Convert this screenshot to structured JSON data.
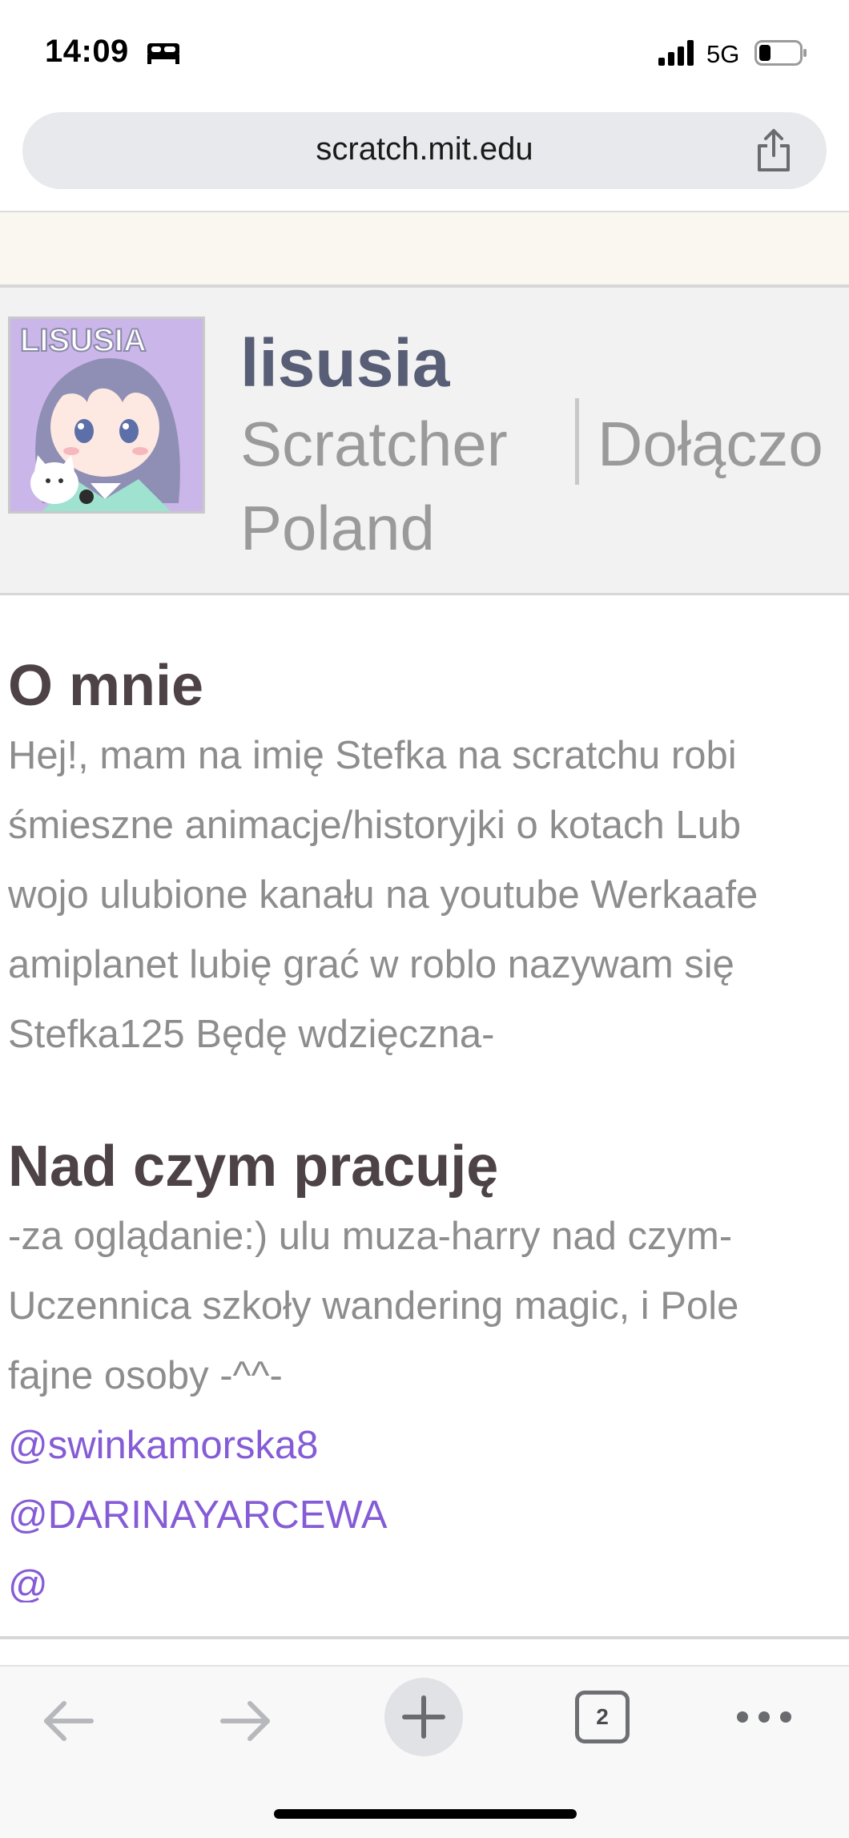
{
  "status": {
    "time": "14:09",
    "network": "5G"
  },
  "browser": {
    "url": "scratch.mit.edu",
    "tab_count": "2"
  },
  "profile": {
    "username": "lisusia",
    "role": "Scratcher",
    "joined": "Dołączo",
    "country": "Poland",
    "avatar_text": "LISUSIA"
  },
  "about": {
    "title": "O mnie",
    "lines": [
      "Hej!, mam na imię Stefka na scratchu robi",
      "śmieszne animacje/historyjki o kotach Lub",
      "wojo ulubione kanału na youtube Werkaafe",
      "amiplanet lubię grać w roblo nazywam się",
      "Stefka125 Będę wdzięczna-"
    ]
  },
  "working_on": {
    "title": "Nad czym pracuję",
    "lines": [
      "-za oglądanie:) ulu muza-harry nad czym-",
      "Uczennica szkoły wandering magic, i Pole",
      "fajne osoby -^^-"
    ],
    "mentions": [
      "@swinkamorska8",
      "@DARINAYARCEWA"
    ]
  },
  "colors": {
    "accent": "#855cd6",
    "heading": "#4d4246",
    "muted": "#8d8d8d"
  }
}
